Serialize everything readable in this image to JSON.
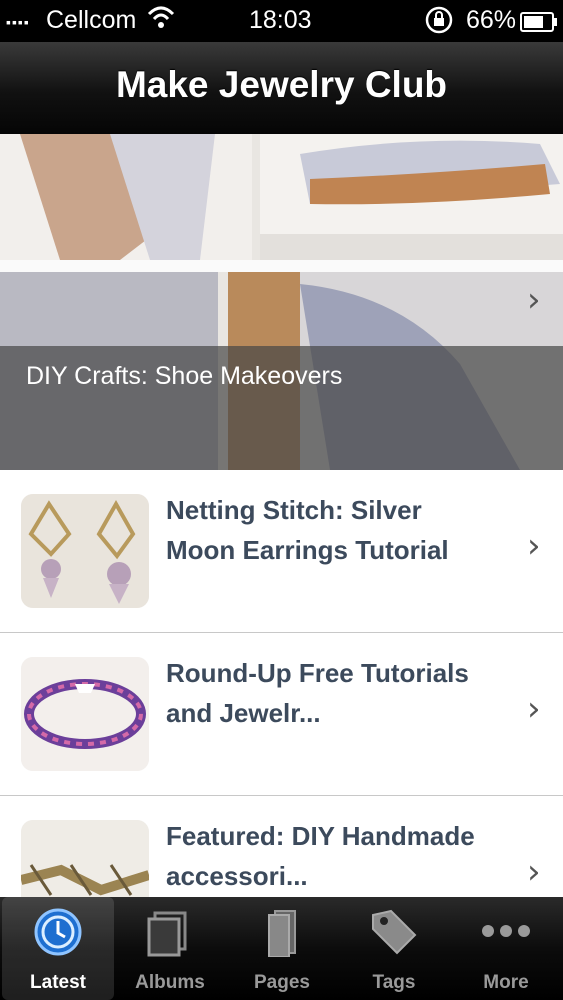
{
  "status_bar": {
    "carrier": "Cellcom",
    "time": "18:03",
    "battery": "66%"
  },
  "navbar": {
    "title": "Make Jewelry Club"
  },
  "featured": {
    "caption": "DIY Crafts: Shoe Makeovers"
  },
  "posts": [
    {
      "title": "Netting Stitch: Silver Moon Earrings Tutorial"
    },
    {
      "title": "Round-Up Free Tutorials and Jewelr..."
    },
    {
      "title": "Featured: DIY Handmade accessori..."
    }
  ],
  "tabbar": {
    "tabs": [
      {
        "label": "Latest",
        "icon": "clock-icon",
        "active": true
      },
      {
        "label": "Albums",
        "icon": "albums-icon"
      },
      {
        "label": "Pages",
        "icon": "pages-icon"
      },
      {
        "label": "Tags",
        "icon": "tag-icon"
      },
      {
        "label": "More",
        "icon": "more-dots-icon"
      }
    ]
  }
}
